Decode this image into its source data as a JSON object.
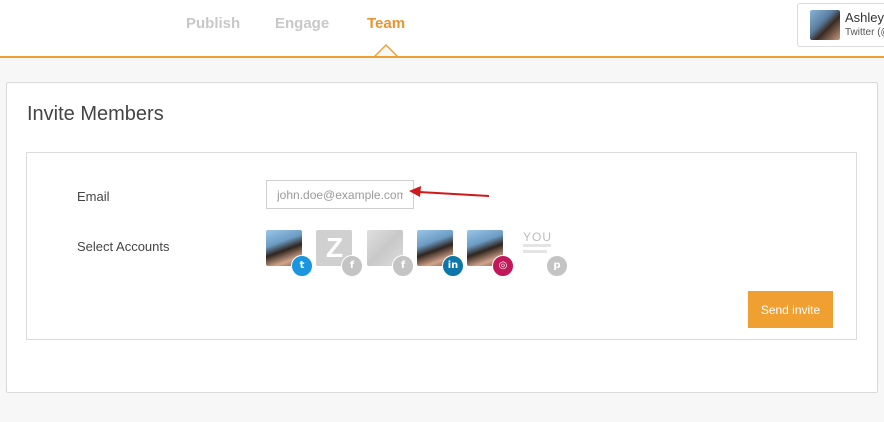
{
  "nav": {
    "tabs": [
      {
        "label": "Publish",
        "active": false
      },
      {
        "label": "Engage",
        "active": false
      },
      {
        "label": "Team",
        "active": true
      }
    ],
    "accent_color": "#f0a030"
  },
  "user": {
    "name": "Ashley",
    "subtitle": "Twitter (@"
  },
  "panel": {
    "title": "Invite Members",
    "email_label": "Email",
    "email_placeholder": "john.doe@example.com",
    "accounts_label": "Select Accounts",
    "accounts": [
      {
        "network": "twitter",
        "badge_icon": "twitter-icon",
        "badge_glyph": "t",
        "badge_color": "#1b95e0",
        "avatar": "photo"
      },
      {
        "network": "facebook",
        "badge_icon": "facebook-icon",
        "badge_glyph": "f",
        "badge_color": "#c4c4c4",
        "avatar": "z-logo",
        "avatar_text": "Z"
      },
      {
        "network": "facebook",
        "badge_icon": "facebook-icon",
        "badge_glyph": "f",
        "badge_color": "#c4c4c4",
        "avatar": "grey-image"
      },
      {
        "network": "linkedin",
        "badge_icon": "linkedin-icon",
        "badge_glyph": "in",
        "badge_color": "#0e76a8",
        "avatar": "photo"
      },
      {
        "network": "instagram",
        "badge_icon": "instagram-icon",
        "badge_glyph": "◎",
        "badge_color": "#c2185b",
        "avatar": "photo"
      },
      {
        "network": "pinterest",
        "badge_icon": "pinterest-icon",
        "badge_glyph": "p",
        "badge_color": "#c4c4c4",
        "avatar": "you-logo",
        "avatar_text": "YOU"
      }
    ],
    "send_button_label": "Send invite"
  }
}
